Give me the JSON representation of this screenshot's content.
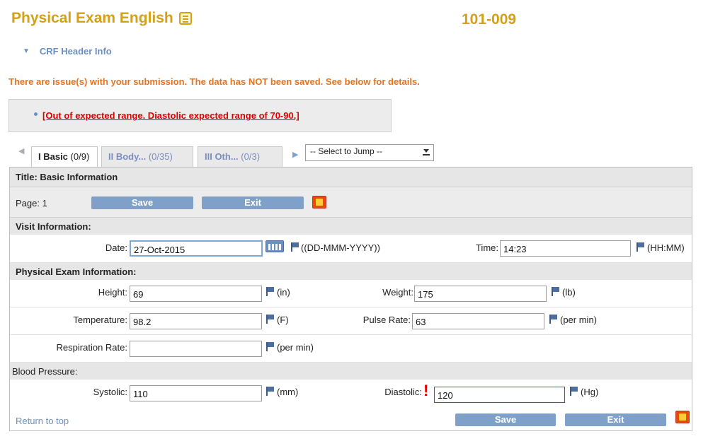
{
  "header": {
    "title": "Physical Exam English",
    "subject_id": "101-009",
    "crf_header_label": "CRF Header Info"
  },
  "error": {
    "message": "There are issue(s) with your submission. The data has NOT been saved. See below for details.",
    "issues": [
      "[Out of expected range. Diastolic expected range of 70-90.]"
    ]
  },
  "tabs": [
    {
      "name": "I Basic",
      "count": "(0/9)"
    },
    {
      "name": "II Body...",
      "count": "(0/35)"
    },
    {
      "name": "III Oth...",
      "count": "(0/3)"
    }
  ],
  "jump_select": {
    "selected": "-- Select to Jump --"
  },
  "form": {
    "title": "Title: Basic Information",
    "page_label": "Page: 1",
    "save_label": "Save",
    "exit_label": "Exit",
    "sections": {
      "visit": "Visit Information:",
      "physical": "Physical Exam Information:",
      "bp": "Blood Pressure:"
    },
    "fields": {
      "date": {
        "label": "Date:",
        "value": "27-Oct-2015",
        "unit": "((DD-MMM-YYYY))"
      },
      "time": {
        "label": "Time:",
        "value": "14:23",
        "unit": "(HH:MM)"
      },
      "height": {
        "label": "Height:",
        "value": "69",
        "unit": "(in)"
      },
      "weight": {
        "label": "Weight:",
        "value": "175",
        "unit": "(lb)"
      },
      "temperature": {
        "label": "Temperature:",
        "value": "98.2",
        "unit": "(F)"
      },
      "pulse": {
        "label": "Pulse Rate:",
        "value": "63",
        "unit": "(per min)"
      },
      "respiration": {
        "label": "Respiration Rate:",
        "value": "",
        "unit": "(per min)"
      },
      "systolic": {
        "label": "Systolic:",
        "value": "110",
        "unit": "(mm)"
      },
      "diastolic": {
        "label": "Diastolic:",
        "value": "120",
        "unit": "(Hg)"
      }
    },
    "return_link": "Return to top"
  },
  "colors": {
    "brand": "#d4a017",
    "error": "#e8731c",
    "issue": "#e00000",
    "button": "#7fa0c8"
  }
}
